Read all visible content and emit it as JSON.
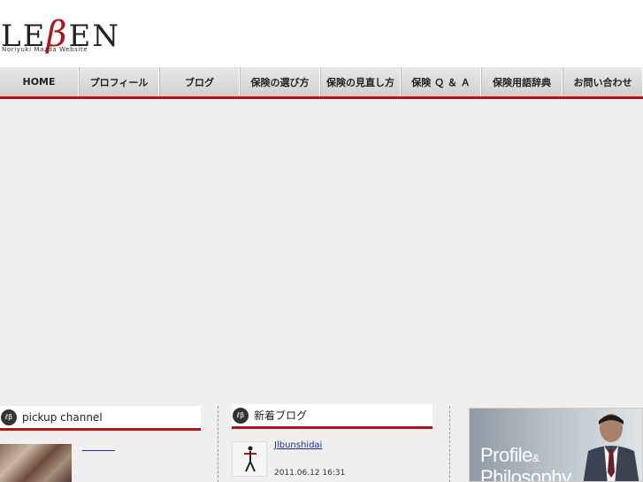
{
  "logo": {
    "wordmark_left": "LE",
    "wordmark_beta": "β",
    "wordmark_right": "EN",
    "subtitle": "Noriyuki Mazda Website"
  },
  "nav": {
    "items": [
      {
        "label": "HOME"
      },
      {
        "label": "プロフィール"
      },
      {
        "label": "ブログ"
      },
      {
        "label": "保険の選び方"
      },
      {
        "label": "保険の見直し方"
      },
      {
        "label": "保険 Ｑ ＆ Ａ"
      },
      {
        "label": "保険用語辞典"
      },
      {
        "label": "お問い合わせ"
      }
    ]
  },
  "pickup": {
    "title": "pickup channel",
    "icon": "logo-badge-icon"
  },
  "blog": {
    "title": "新着ブログ",
    "icon": "logo-badge-icon",
    "entries": [
      {
        "title": "Jlbunshidai",
        "date": "2011.06.12 16:31"
      }
    ]
  },
  "profile": {
    "line1": "Profile",
    "amp": "&",
    "line2": "Philosophy"
  },
  "colors": {
    "accent": "#b0141c",
    "link": "#1a2a9a",
    "background": "#efefef"
  }
}
